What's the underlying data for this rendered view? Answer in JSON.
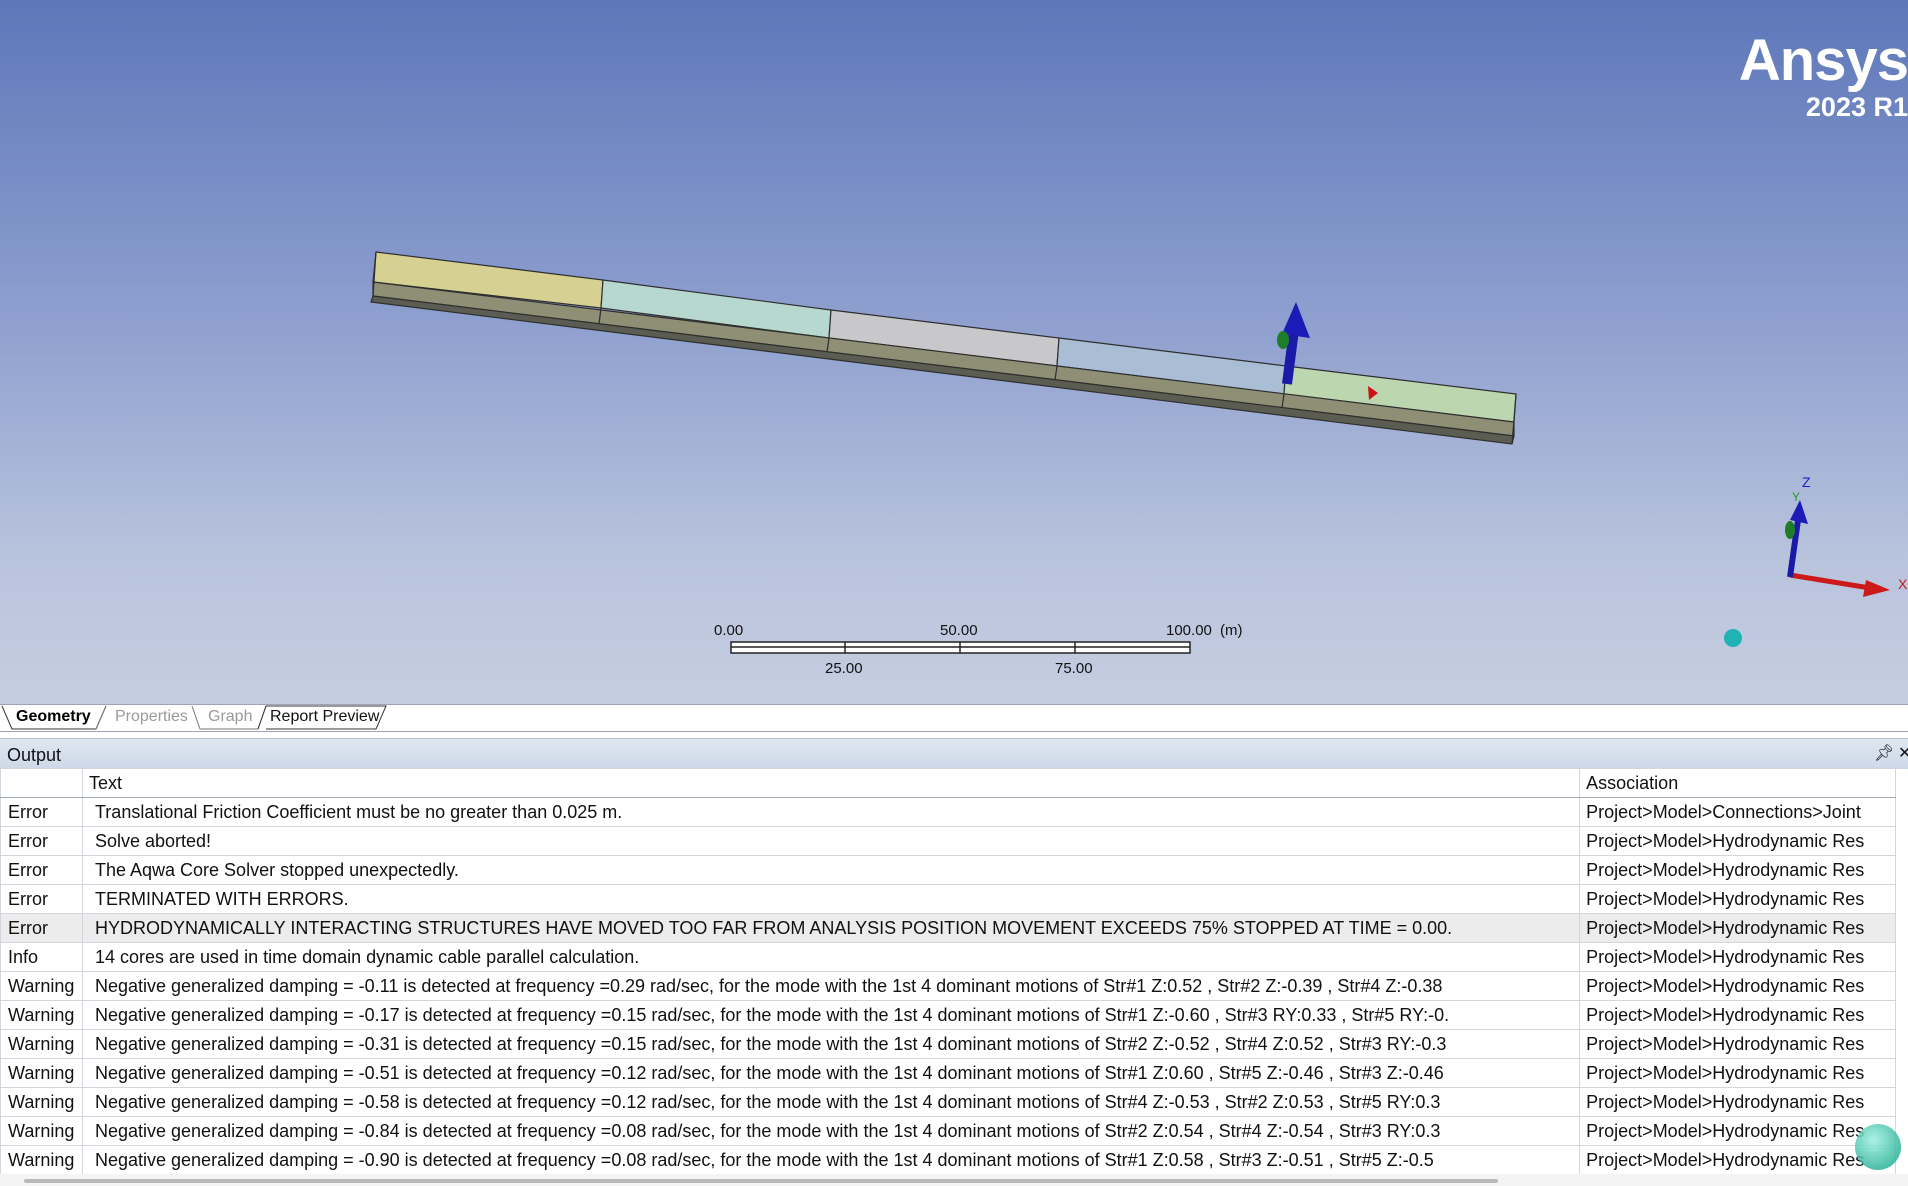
{
  "brand": {
    "name": "Ansys",
    "version": "2023 R1"
  },
  "viewport": {
    "scale_bar": {
      "unit": "(m)",
      "top_labels": [
        "0.00",
        "50.00",
        "100.00"
      ],
      "bottom_labels": [
        "25.00",
        "75.00"
      ]
    },
    "triad": {
      "z_label": "Z",
      "y_label": "Y",
      "x_label": "X"
    }
  },
  "tabs": [
    {
      "label": "Geometry",
      "active": true
    },
    {
      "label": "Properties",
      "active": false
    },
    {
      "label": "Graph",
      "active": false
    },
    {
      "label": "Report Preview",
      "active": false
    }
  ],
  "output": {
    "title": "Output",
    "pin_icon": "pin-icon",
    "close_icon": "close-icon",
    "columns": [
      "",
      "Text",
      "Association"
    ],
    "rows": [
      {
        "level": "Error",
        "text": "Translational Friction Coefficient must be no greater than 0.025 m.",
        "association": "Project>Model>Connections>Joint"
      },
      {
        "level": "Error",
        "text": "Solve aborted!",
        "association": "Project>Model>Hydrodynamic Res"
      },
      {
        "level": "Error",
        "text": "The Aqwa Core Solver stopped unexpectedly.",
        "association": "Project>Model>Hydrodynamic Res"
      },
      {
        "level": "Error",
        "text": "TERMINATED WITH ERRORS.",
        "association": "Project>Model>Hydrodynamic Res"
      },
      {
        "level": "Error",
        "text": "HYDRODYNAMICALLY INTERACTING STRUCTURES HAVE MOVED TOO FAR FROM ANALYSIS POSITION MOVEMENT EXCEEDS 75% STOPPED AT TIME = 0.00.",
        "association": "Project>Model>Hydrodynamic Res"
      },
      {
        "level": "Info",
        "text": "14 cores are used in time domain dynamic cable parallel calculation.",
        "association": "Project>Model>Hydrodynamic Res"
      },
      {
        "level": "Warning",
        "text": "Negative generalized damping = -0.11 is detected at frequency =0.29 rad/sec, for the mode with the 1st 4 dominant motions of Str#1 Z:0.52 , Str#2 Z:-0.39 , Str#4 Z:-0.38",
        "association": "Project>Model>Hydrodynamic Res"
      },
      {
        "level": "Warning",
        "text": "Negative generalized damping = -0.17 is detected at frequency =0.15 rad/sec, for the mode with the 1st 4 dominant motions of Str#1 Z:-0.60 , Str#3 RY:0.33 , Str#5 RY:-0.",
        "association": "Project>Model>Hydrodynamic Res"
      },
      {
        "level": "Warning",
        "text": "Negative generalized damping = -0.31 is detected at frequency =0.15 rad/sec, for the mode with the 1st 4 dominant motions of Str#2 Z:-0.52 , Str#4 Z:0.52 , Str#3 RY:-0.3",
        "association": "Project>Model>Hydrodynamic Res"
      },
      {
        "level": "Warning",
        "text": "Negative generalized damping = -0.51 is detected at frequency =0.12 rad/sec, for the mode with the 1st 4 dominant motions of Str#1 Z:0.60 , Str#5 Z:-0.46 , Str#3 Z:-0.46",
        "association": "Project>Model>Hydrodynamic Res"
      },
      {
        "level": "Warning",
        "text": "Negative generalized damping = -0.58 is detected at frequency =0.12 rad/sec, for the mode with the 1st 4 dominant motions of Str#4 Z:-0.53 , Str#2 Z:0.53 , Str#5 RY:0.3",
        "association": "Project>Model>Hydrodynamic Res"
      },
      {
        "level": "Warning",
        "text": "Negative generalized damping = -0.84 is detected at frequency =0.08 rad/sec, for the mode with the 1st 4 dominant motions of Str#2 Z:0.54 , Str#4 Z:-0.54 , Str#3 RY:0.3",
        "association": "Project>Model>Hydrodynamic Res"
      },
      {
        "level": "Warning",
        "text": "Negative generalized damping = -0.90 is detected at frequency =0.08 rad/sec, for the mode with the 1st 4 dominant motions of Str#1 Z:0.58 , Str#3 Z:-0.51 , Str#5 Z:-0.5",
        "association": "Project>Model>Hydrodynamic Res"
      }
    ]
  }
}
